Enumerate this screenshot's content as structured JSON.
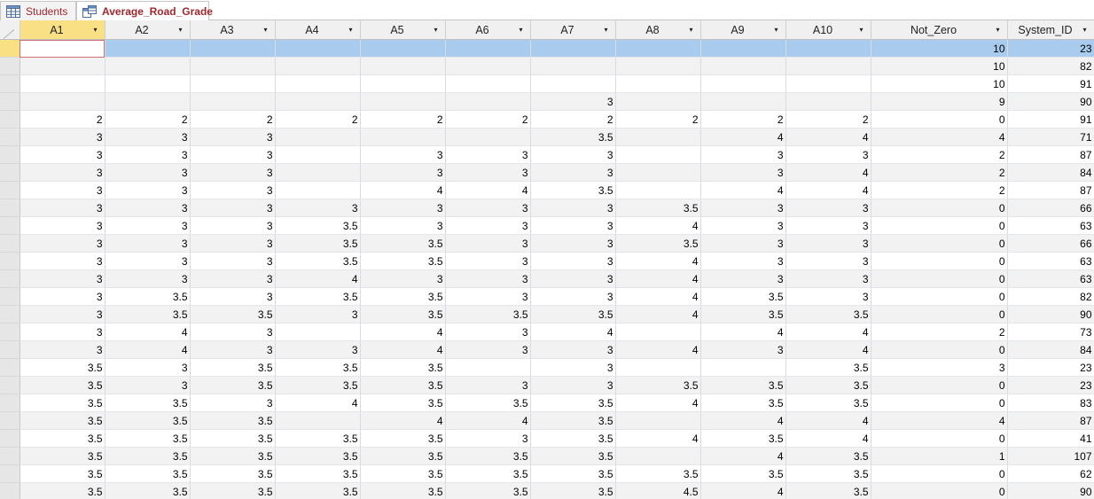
{
  "tabs": [
    {
      "label": "Students",
      "icon": "table-icon",
      "active": false
    },
    {
      "label": "Average_Road_Grade",
      "icon": "query-icon",
      "active": true
    }
  ],
  "columns": [
    "A1",
    "A2",
    "A3",
    "A4",
    "A5",
    "A6",
    "A7",
    "A8",
    "A9",
    "A10",
    "Not_Zero",
    "System_ID"
  ],
  "rows": [
    [
      "",
      "",
      "",
      "",
      "",
      "",
      "",
      "",
      "",
      "",
      "10",
      "23"
    ],
    [
      "",
      "",
      "",
      "",
      "",
      "",
      "",
      "",
      "",
      "",
      "10",
      "82"
    ],
    [
      "",
      "",
      "",
      "",
      "",
      "",
      "",
      "",
      "",
      "",
      "10",
      "91"
    ],
    [
      "",
      "",
      "",
      "",
      "",
      "",
      "3",
      "",
      "",
      "",
      "9",
      "90"
    ],
    [
      "2",
      "2",
      "2",
      "2",
      "2",
      "2",
      "2",
      "2",
      "2",
      "2",
      "0",
      "91"
    ],
    [
      "3",
      "3",
      "3",
      "",
      "",
      "",
      "3.5",
      "",
      "4",
      "4",
      "4",
      "71"
    ],
    [
      "3",
      "3",
      "3",
      "",
      "3",
      "3",
      "3",
      "",
      "3",
      "3",
      "2",
      "87"
    ],
    [
      "3",
      "3",
      "3",
      "",
      "3",
      "3",
      "3",
      "",
      "3",
      "4",
      "2",
      "84"
    ],
    [
      "3",
      "3",
      "3",
      "",
      "4",
      "4",
      "3.5",
      "",
      "4",
      "4",
      "2",
      "87"
    ],
    [
      "3",
      "3",
      "3",
      "3",
      "3",
      "3",
      "3",
      "3.5",
      "3",
      "3",
      "0",
      "66"
    ],
    [
      "3",
      "3",
      "3",
      "3.5",
      "3",
      "3",
      "3",
      "4",
      "3",
      "3",
      "0",
      "63"
    ],
    [
      "3",
      "3",
      "3",
      "3.5",
      "3.5",
      "3",
      "3",
      "3.5",
      "3",
      "3",
      "0",
      "66"
    ],
    [
      "3",
      "3",
      "3",
      "3.5",
      "3.5",
      "3",
      "3",
      "4",
      "3",
      "3",
      "0",
      "63"
    ],
    [
      "3",
      "3",
      "3",
      "4",
      "3",
      "3",
      "3",
      "4",
      "3",
      "3",
      "0",
      "63"
    ],
    [
      "3",
      "3.5",
      "3",
      "3.5",
      "3.5",
      "3",
      "3",
      "4",
      "3.5",
      "3",
      "0",
      "82"
    ],
    [
      "3",
      "3.5",
      "3.5",
      "3",
      "3.5",
      "3.5",
      "3.5",
      "4",
      "3.5",
      "3.5",
      "0",
      "90"
    ],
    [
      "3",
      "4",
      "3",
      "",
      "4",
      "3",
      "4",
      "",
      "4",
      "4",
      "2",
      "73"
    ],
    [
      "3",
      "4",
      "3",
      "3",
      "4",
      "3",
      "3",
      "4",
      "3",
      "4",
      "0",
      "84"
    ],
    [
      "3.5",
      "3",
      "3.5",
      "3.5",
      "3.5",
      "",
      "3",
      "",
      "",
      "3.5",
      "3",
      "23"
    ],
    [
      "3.5",
      "3",
      "3.5",
      "3.5",
      "3.5",
      "3",
      "3",
      "3.5",
      "3.5",
      "3.5",
      "0",
      "23"
    ],
    [
      "3.5",
      "3.5",
      "3",
      "4",
      "3.5",
      "3.5",
      "3.5",
      "4",
      "3.5",
      "3.5",
      "0",
      "83"
    ],
    [
      "3.5",
      "3.5",
      "3.5",
      "",
      "4",
      "4",
      "3.5",
      "",
      "4",
      "4",
      "4",
      "87"
    ],
    [
      "3.5",
      "3.5",
      "3.5",
      "3.5",
      "3.5",
      "3",
      "3.5",
      "4",
      "3.5",
      "4",
      "0",
      "41"
    ],
    [
      "3.5",
      "3.5",
      "3.5",
      "3.5",
      "3.5",
      "3.5",
      "3.5",
      "",
      "4",
      "3.5",
      "1",
      "107"
    ],
    [
      "3.5",
      "3.5",
      "3.5",
      "3.5",
      "3.5",
      "3.5",
      "3.5",
      "3.5",
      "3.5",
      "3.5",
      "0",
      "62"
    ],
    [
      "3.5",
      "3.5",
      "3.5",
      "3.5",
      "3.5",
      "3.5",
      "3.5",
      "4.5",
      "4",
      "3.5",
      "0",
      "90"
    ]
  ],
  "colors": {
    "tab_text": "#a4262c",
    "current_row": "#a8cbee",
    "selected_header": "#f9e085"
  }
}
